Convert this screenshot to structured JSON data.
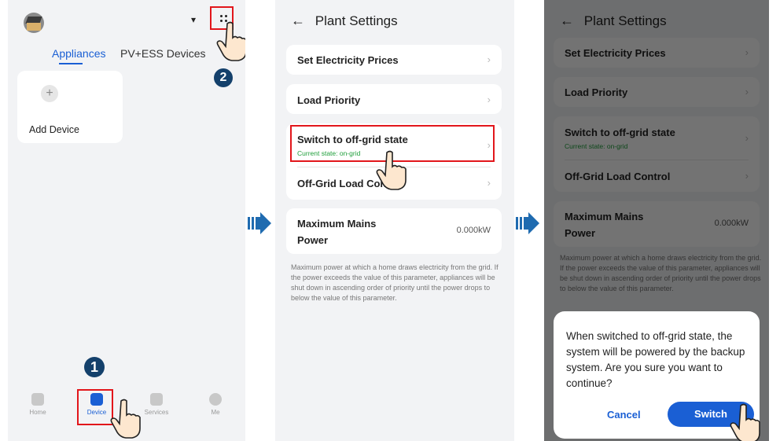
{
  "step1": {
    "tabs": [
      "Appliances",
      "PV+ESS Devices"
    ],
    "add_device_label": "Add Device",
    "plus_symbol": "+",
    "nav": [
      "Home",
      "Device",
      "Services",
      "Me"
    ],
    "badge1": "1",
    "badge2": "2"
  },
  "step2": {
    "title": "Plant Settings",
    "items": {
      "prices": "Set Electricity Prices",
      "priority": "Load Priority",
      "offgrid": "Switch to off-grid state",
      "offgrid_state": "Current state: on-grid",
      "load_control": "Off-Grid Load Control",
      "max_power": "Maximum Mains Power",
      "max_power_value": "0.000kW"
    },
    "description": "Maximum power at which a home draws electricity from the grid. If the power exceeds the value of this parameter, appliances will be shut down in ascending order of priority until the power drops to below the value of this parameter."
  },
  "step3": {
    "dialog_message": "When switched to off-grid state, the system will be powered by the backup system. Are you sure you want to continue?",
    "cancel": "Cancel",
    "switch": "Switch"
  },
  "icons": {
    "back": "←",
    "chevron": "›",
    "dropdown": "▾"
  },
  "colors": {
    "accent": "#1a5fd4",
    "highlight": "#e2161b",
    "status_green": "#1e9e3a",
    "badge": "#14406b",
    "arrow": "#1f6bb0"
  }
}
